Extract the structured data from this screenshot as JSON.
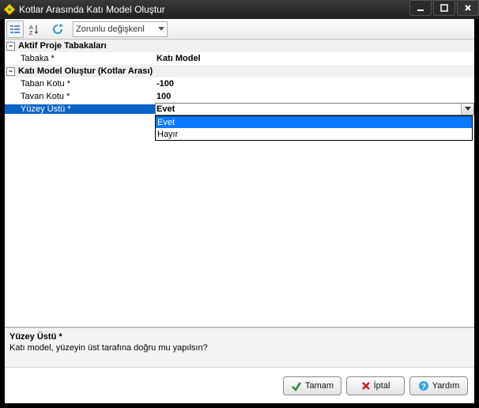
{
  "window": {
    "title": "Kotlar Arasında Katı Model Oluştur"
  },
  "toolbar": {
    "combo_text": "Zorunlu değişkenl"
  },
  "categories": {
    "cat1": {
      "label": "Aktif Proje Tabakaları"
    },
    "cat2": {
      "label": "Katı Model Oluştur (Kotlar Arası)"
    }
  },
  "props": {
    "tabaka": {
      "label": "Tabaka *",
      "value": "Katı Model"
    },
    "taban": {
      "label": "Taban Kotu *",
      "value": "-100"
    },
    "tavan": {
      "label": "Tavan Kotu *",
      "value": "100"
    },
    "yuzey": {
      "label": "Yüzey Üstü *",
      "value": "Evet"
    }
  },
  "dropdown": {
    "opt1": "Evet",
    "opt2": "Hayır"
  },
  "description": {
    "title": "Yüzey Üstü *",
    "text": "Katı model, yüzeyin üst tarafına doğru mu yapılsın?"
  },
  "buttons": {
    "ok": "Tamam",
    "cancel": "İptal",
    "help": "Yardım"
  }
}
